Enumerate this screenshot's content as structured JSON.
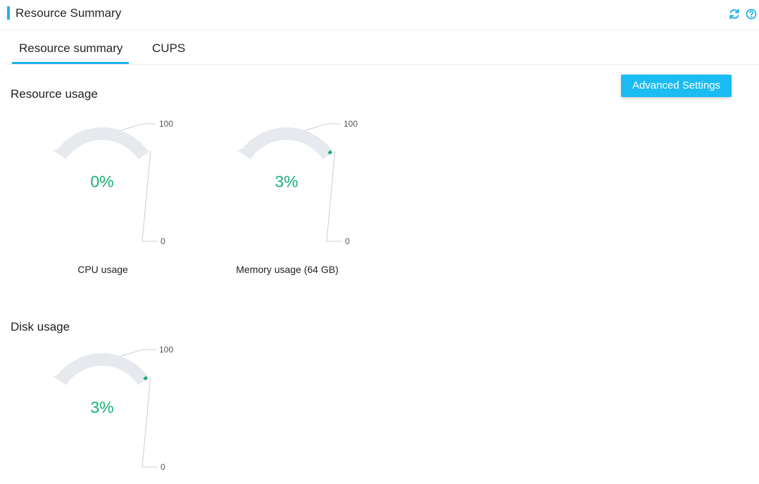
{
  "header": {
    "title": "Resource Summary",
    "refresh_icon": "refresh-icon",
    "help_icon": "help-icon",
    "accent_color": "#1fb1ec"
  },
  "tabs": [
    {
      "label": "Resource summary",
      "active": true
    },
    {
      "label": "CUPS",
      "active": false
    }
  ],
  "toolbar": {
    "advanced_settings_label": "Advanced Settings"
  },
  "sections": {
    "resource_usage_title": "Resource usage",
    "disk_usage_title": "Disk usage"
  },
  "gauges": {
    "cpu": {
      "value_text": "0%",
      "value": 0,
      "max_label": "100",
      "min_label": "0",
      "label": "CPU usage"
    },
    "memory": {
      "value_text": "3%",
      "value": 3,
      "max_label": "100",
      "min_label": "0",
      "label": "Memory usage (64 GB)"
    },
    "disk": {
      "value_text": "3%",
      "value": 3,
      "max_label": "100",
      "min_label": "0"
    }
  },
  "colors": {
    "track": "#e6e9ee",
    "fill": "#1aaf76",
    "button": "#1abcf3"
  }
}
